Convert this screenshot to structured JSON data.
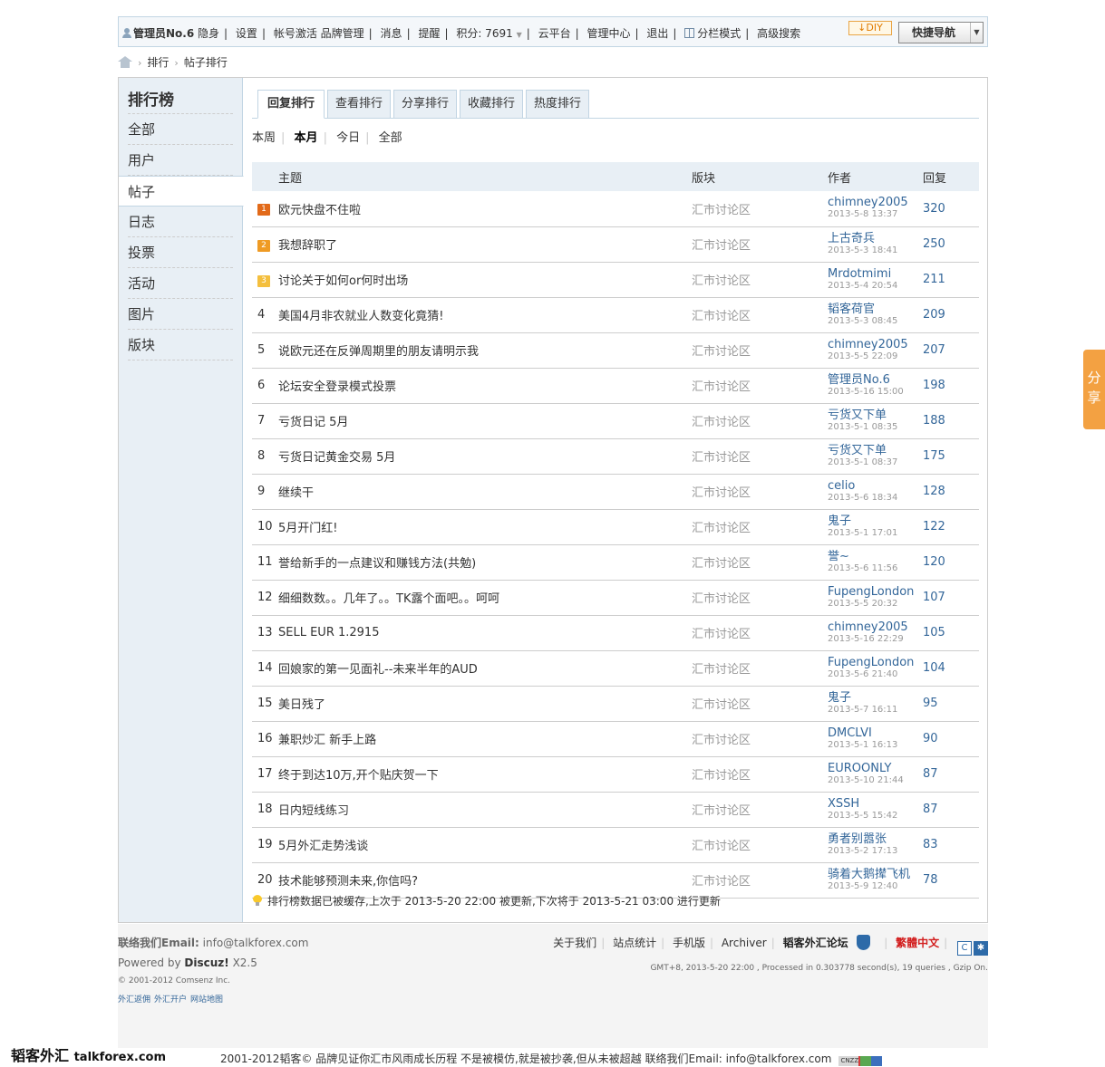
{
  "topbar": {
    "username": "管理员No.6",
    "invisible": "隐身",
    "settings": "设置",
    "activate": "帐号激活",
    "brand_mgmt": "品牌管理",
    "messages": "消息",
    "reminders": "提醒",
    "points": "积分: 7691",
    "cloud": "云平台",
    "admin": "管理中心",
    "logout": "退出",
    "column_mode": "分栏模式",
    "adv_search": "高级搜索",
    "diy": "DIY",
    "quicknav": "快捷导航"
  },
  "breadcrumb": {
    "section": "排行",
    "current": "帖子排行"
  },
  "sidebar": {
    "title": "排行榜",
    "items": [
      {
        "label": "全部",
        "active": false
      },
      {
        "label": "用户",
        "active": false
      },
      {
        "label": "帖子",
        "active": true
      },
      {
        "label": "日志",
        "active": false
      },
      {
        "label": "投票",
        "active": false
      },
      {
        "label": "活动",
        "active": false
      },
      {
        "label": "图片",
        "active": false
      },
      {
        "label": "版块",
        "active": false
      }
    ]
  },
  "tabs": [
    "回复排行",
    "查看排行",
    "分享排行",
    "收藏排行",
    "热度排行"
  ],
  "periods": [
    "本周",
    "本月",
    "今日",
    "全部"
  ],
  "table": {
    "headers": {
      "subject": "主题",
      "forum": "版块",
      "author": "作者",
      "replies": "回复"
    },
    "rows": [
      {
        "rank": "1",
        "subject": "欧元快盘不住啦",
        "forum": "汇市讨论区",
        "author": "chimney2005",
        "date": "2013-5-8 13:37",
        "replies": "320"
      },
      {
        "rank": "2",
        "subject": "我想辞职了",
        "forum": "汇市讨论区",
        "author": "上古奇兵",
        "date": "2013-5-3 18:41",
        "replies": "250"
      },
      {
        "rank": "3",
        "subject": "讨论关于如何or何时出场",
        "forum": "汇市讨论区",
        "author": "Mrdotmimi",
        "date": "2013-5-4 20:54",
        "replies": "211"
      },
      {
        "rank": "4",
        "subject": "美国4月非农就业人数变化竟猜!",
        "forum": "汇市讨论区",
        "author": "韬客荷官",
        "date": "2013-5-3 08:45",
        "replies": "209"
      },
      {
        "rank": "5",
        "subject": "说欧元还在反弹周期里的朋友请明示我",
        "forum": "汇市讨论区",
        "author": "chimney2005",
        "date": "2013-5-5 22:09",
        "replies": "207"
      },
      {
        "rank": "6",
        "subject": "论坛安全登录模式投票",
        "forum": "汇市讨论区",
        "author": "管理员No.6",
        "date": "2013-5-16 15:00",
        "replies": "198"
      },
      {
        "rank": "7",
        "subject": "亏货日记 5月",
        "forum": "汇市讨论区",
        "author": "亏货又下单",
        "date": "2013-5-1 08:35",
        "replies": "188"
      },
      {
        "rank": "8",
        "subject": "亏货日记黄金交易 5月",
        "forum": "汇市讨论区",
        "author": "亏货又下单",
        "date": "2013-5-1 08:37",
        "replies": "175"
      },
      {
        "rank": "9",
        "subject": "继续干",
        "forum": "汇市讨论区",
        "author": "celio",
        "date": "2013-5-6 18:34",
        "replies": "128"
      },
      {
        "rank": "10",
        "subject": "5月开门红!",
        "forum": "汇市讨论区",
        "author": "鬼子",
        "date": "2013-5-1 17:01",
        "replies": "122"
      },
      {
        "rank": "11",
        "subject": "誉给新手的一点建议和赚钱方法(共勉)",
        "forum": "汇市讨论区",
        "author": "誉~",
        "date": "2013-5-6 11:56",
        "replies": "120"
      },
      {
        "rank": "12",
        "subject": "细细数数。。几年了。。TK露个面吧。。呵呵",
        "forum": "汇市讨论区",
        "author": "FupengLondon",
        "date": "2013-5-5 20:32",
        "replies": "107"
      },
      {
        "rank": "13",
        "subject": "SELL EUR 1.2915",
        "forum": "汇市讨论区",
        "author": "chimney2005",
        "date": "2013-5-16 22:29",
        "replies": "105"
      },
      {
        "rank": "14",
        "subject": "回娘家的第一见面礼--未来半年的AUD",
        "forum": "汇市讨论区",
        "author": "FupengLondon",
        "date": "2013-5-6 21:40",
        "replies": "104"
      },
      {
        "rank": "15",
        "subject": "美日残了",
        "forum": "汇市讨论区",
        "author": "鬼子",
        "date": "2013-5-7 16:11",
        "replies": "95"
      },
      {
        "rank": "16",
        "subject": "兼职炒汇 新手上路",
        "forum": "汇市讨论区",
        "author": "DMCLVI",
        "date": "2013-5-1 16:13",
        "replies": "90"
      },
      {
        "rank": "17",
        "subject": "终于到达10万,开个贴庆贺一下",
        "forum": "汇市讨论区",
        "author": "EUROONLY",
        "date": "2013-5-10 21:44",
        "replies": "87"
      },
      {
        "rank": "18",
        "subject": "日内短线练习",
        "forum": "汇市讨论区",
        "author": "XSSH",
        "date": "2013-5-5 15:42",
        "replies": "87"
      },
      {
        "rank": "19",
        "subject": "5月外汇走势浅谈",
        "forum": "汇市讨论区",
        "author": "勇者别嚣张",
        "date": "2013-5-2 17:13",
        "replies": "83"
      },
      {
        "rank": "20",
        "subject": "技术能够预测未来,你信吗?",
        "forum": "汇市讨论区",
        "author": "骑着大鹅撵飞机",
        "date": "2013-5-9 12:40",
        "replies": "78"
      }
    ]
  },
  "cache_note": "排行榜数据已被缓存,上次于 2013-5-20 22:00 被更新,下次将于 2013-5-21 03:00 进行更新",
  "footer": {
    "contact_label": "联络我们Email:",
    "contact_email": "info@talkforex.com",
    "powered_by": "Powered by",
    "discuz": "Discuz!",
    "version": "X2.5",
    "comsenz": "© 2001-2012 Comsenz Inc.",
    "mini_links": [
      "外汇返佣",
      "外汇开户",
      "网站地图"
    ],
    "links": [
      "关于我们",
      "站点统计",
      "手机版",
      "Archiver"
    ],
    "forum_name": "韬客外汇论坛",
    "traditional": "繁體中文",
    "stats": "GMT+8, 2013-5-20 22:00 , Processed in 0.303778 second(s), 19 queries , Gzip On."
  },
  "bottom": {
    "brand_cn": "韬客外汇",
    "brand_en": "talkforex.com",
    "copyright": "2001-2012韬客© 品牌见证你汇市风雨成长历程  不是被模仿,就是被抄袭,但从未被超越     联络我们Email: info@talkforex.com",
    "cnzz": "CNZZ"
  },
  "share": "分享",
  "colors": {
    "link": "#336699",
    "sidebar_bg": "#e8eff5",
    "border": "#c2d5e3",
    "share": "#f3a142"
  }
}
